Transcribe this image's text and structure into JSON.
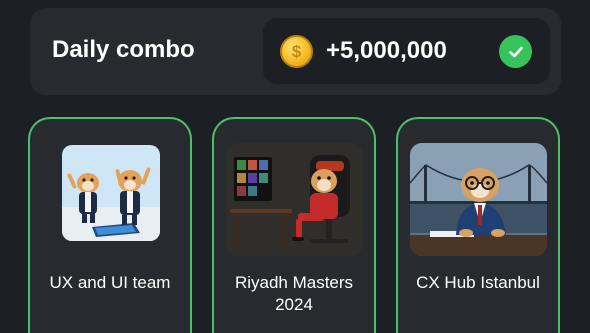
{
  "combo": {
    "title": "Daily combo",
    "reward_amount": "+5,000,000",
    "coin_icon": "coin-icon",
    "status_icon": "checkmark-icon",
    "colors": {
      "accent_green": "#37c35b",
      "card_border": "#4fbf67",
      "coin_gold": "#f7c42f"
    }
  },
  "cards": [
    {
      "label": "UX and UI team",
      "image": "hamsters-dancing-illustration"
    },
    {
      "label": "Riyadh Masters 2024",
      "image": "hamster-gamer-chair-illustration"
    },
    {
      "label": "CX Hub Istanbul",
      "image": "hamster-businessman-bridge-illustration"
    }
  ]
}
